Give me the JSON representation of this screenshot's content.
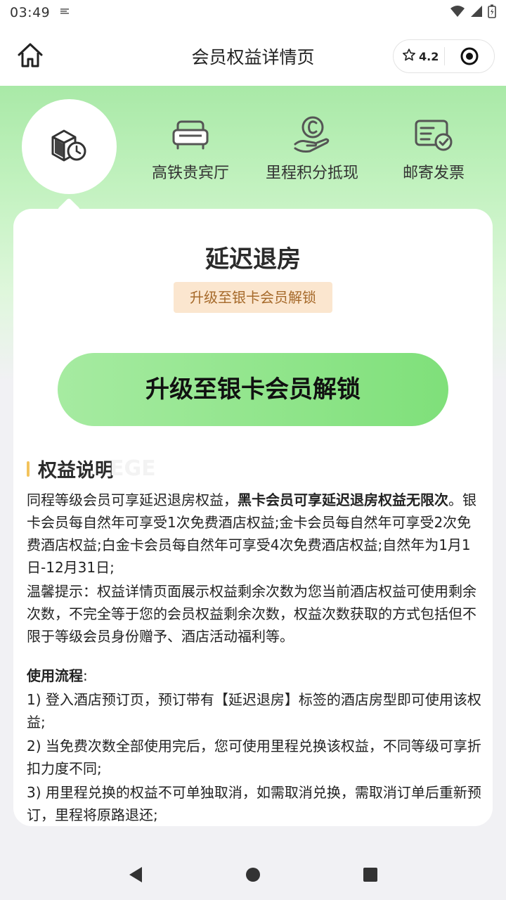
{
  "status_bar": {
    "time": "03:49",
    "sim_icon": "sim-icon",
    "wifi_icon": "wifi-icon",
    "signal_icon": "signal-icon",
    "battery_icon": "battery-icon"
  },
  "header": {
    "title": "会员权益详情页",
    "rating": "4.2",
    "home_icon": "home-icon",
    "star_icon": "star-icon",
    "target_icon": "target-icon"
  },
  "benefit_tabs": [
    {
      "label": "延迟退房",
      "icon": "late-checkout-icon",
      "selected": true
    },
    {
      "label": "高铁贵宾厅",
      "icon": "sofa-icon",
      "selected": false
    },
    {
      "label": "里程积分抵现",
      "icon": "coin-hand-icon",
      "selected": false
    },
    {
      "label": "邮寄发票",
      "icon": "invoice-icon",
      "selected": false
    }
  ],
  "card": {
    "title": "延迟退房",
    "lock_badge": "升级至银卡会员解锁",
    "cta_label": "升级至银卡会员解锁",
    "section_title": "权益说明",
    "section_watermark": "EGE",
    "desc_p1_plain": "同程等级会员可享延迟退房权益，",
    "desc_p1_bold": "黑卡会员可享延迟退房权益无限次",
    "desc_p1_rest": "。银卡会员每自然年可享受1次免费酒店权益;金卡会员每自然年可享受2次免费酒店权益;白金卡会员每自然年可享受4次免费酒店权益;自然年为1月1日-12月31日;",
    "desc_p2": "温馨提示：权益详情页面展示权益剩余次数为您当前酒店权益可使用剩余次数，不完全等于您的会员权益剩余次数，权益次数获取的方式包括但不限于等级会员身份赠予、酒店活动福利等。",
    "flow_title": "使用流程",
    "flow_colon": ":",
    "flow_1": "1) 登入酒店预订页，预订带有【延迟退房】标签的酒店房型即可使用该权益;",
    "flow_2": "2) 当免费次数全部使用完后，您可使用里程兑换该权益，不同等级可享折扣力度不同;",
    "flow_3": "3) 用里程兑换的权益不可单独取消，如需取消兑换，需取消订单后重新预订，里程将原路退还;"
  },
  "nav_bar": {
    "back_icon": "back-icon",
    "home_icon": "nav-home-icon",
    "recents_icon": "recents-icon"
  },
  "colors": {
    "hero_green": "#a9e9a7",
    "cta_green": "#7fe07a",
    "badge_bg": "#fbe6cf",
    "badge_text": "#a66a2b",
    "section_bar": "#f3c35c"
  }
}
